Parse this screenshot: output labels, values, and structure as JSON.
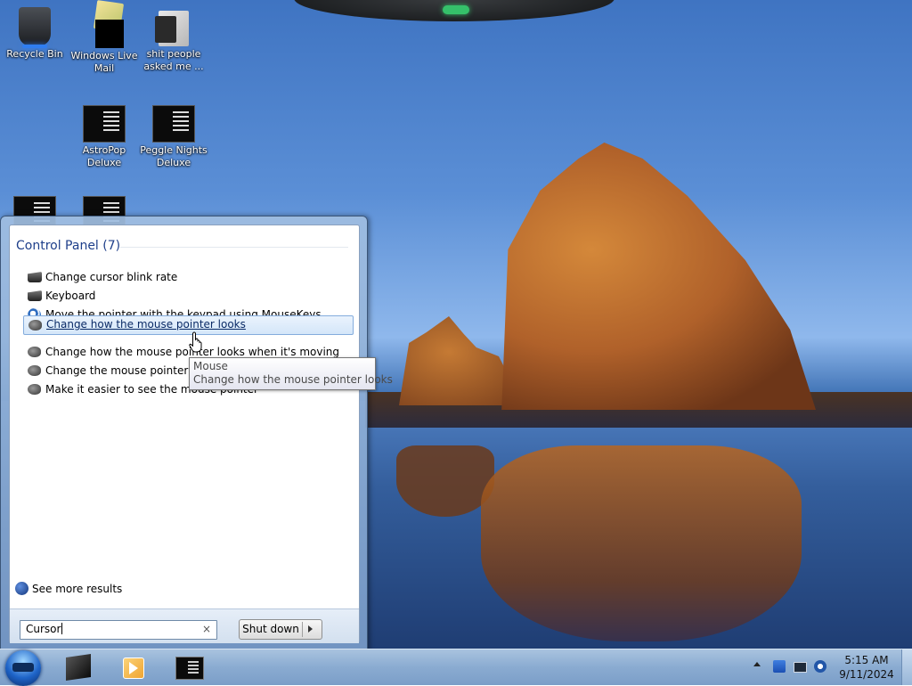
{
  "desktop": {
    "icons": [
      {
        "label": "Recycle Bin",
        "icon": "recycle-bin-icon"
      },
      {
        "label": "Windows Live Mail",
        "icon": "windows-live-mail-icon"
      },
      {
        "label": "shit people asked me ...",
        "icon": "folder-icon"
      },
      {
        "label": "AstroPop Deluxe",
        "icon": "app-icon"
      },
      {
        "label": "Peggle Nights Deluxe",
        "icon": "app-icon"
      }
    ]
  },
  "start_menu": {
    "group_heading": "Control Panel (7)",
    "results": [
      {
        "label": "Change cursor blink rate",
        "icon": "keyboard-icon"
      },
      {
        "label": "Keyboard",
        "icon": "keyboard-icon"
      },
      {
        "label": "Move the pointer with the keypad using MouseKeys",
        "icon": "ease-of-access-icon"
      },
      {
        "label": "Change how the mouse pointer looks",
        "icon": "mouse-icon",
        "selected": true
      },
      {
        "label": "Change how the mouse pointer looks when it's moving",
        "icon": "mouse-icon"
      },
      {
        "label": "Change the mouse pointer display or speed",
        "icon": "mouse-icon"
      },
      {
        "label": "Make it easier to see the mouse pointer",
        "icon": "mouse-icon"
      }
    ],
    "see_more": "See more results",
    "search": {
      "value": "Cursor",
      "clear_icon": "×"
    },
    "shutdown_label": "Shut down"
  },
  "tooltip": {
    "title": "Mouse",
    "description": "Change how the mouse pointer looks"
  },
  "taskbar": {
    "pinned": [
      "3d-cube-app-icon",
      "windows-media-player-icon",
      "app-window-icon"
    ],
    "tray_icons": [
      "action-center-icon",
      "network-icon",
      "volume-icon"
    ],
    "clock": {
      "time": "5:15 AM",
      "date": "9/11/2024"
    }
  },
  "colors": {
    "heading": "#1e3f8a",
    "selection_border": "#84acdd",
    "taskbar": "#8aabd1"
  }
}
